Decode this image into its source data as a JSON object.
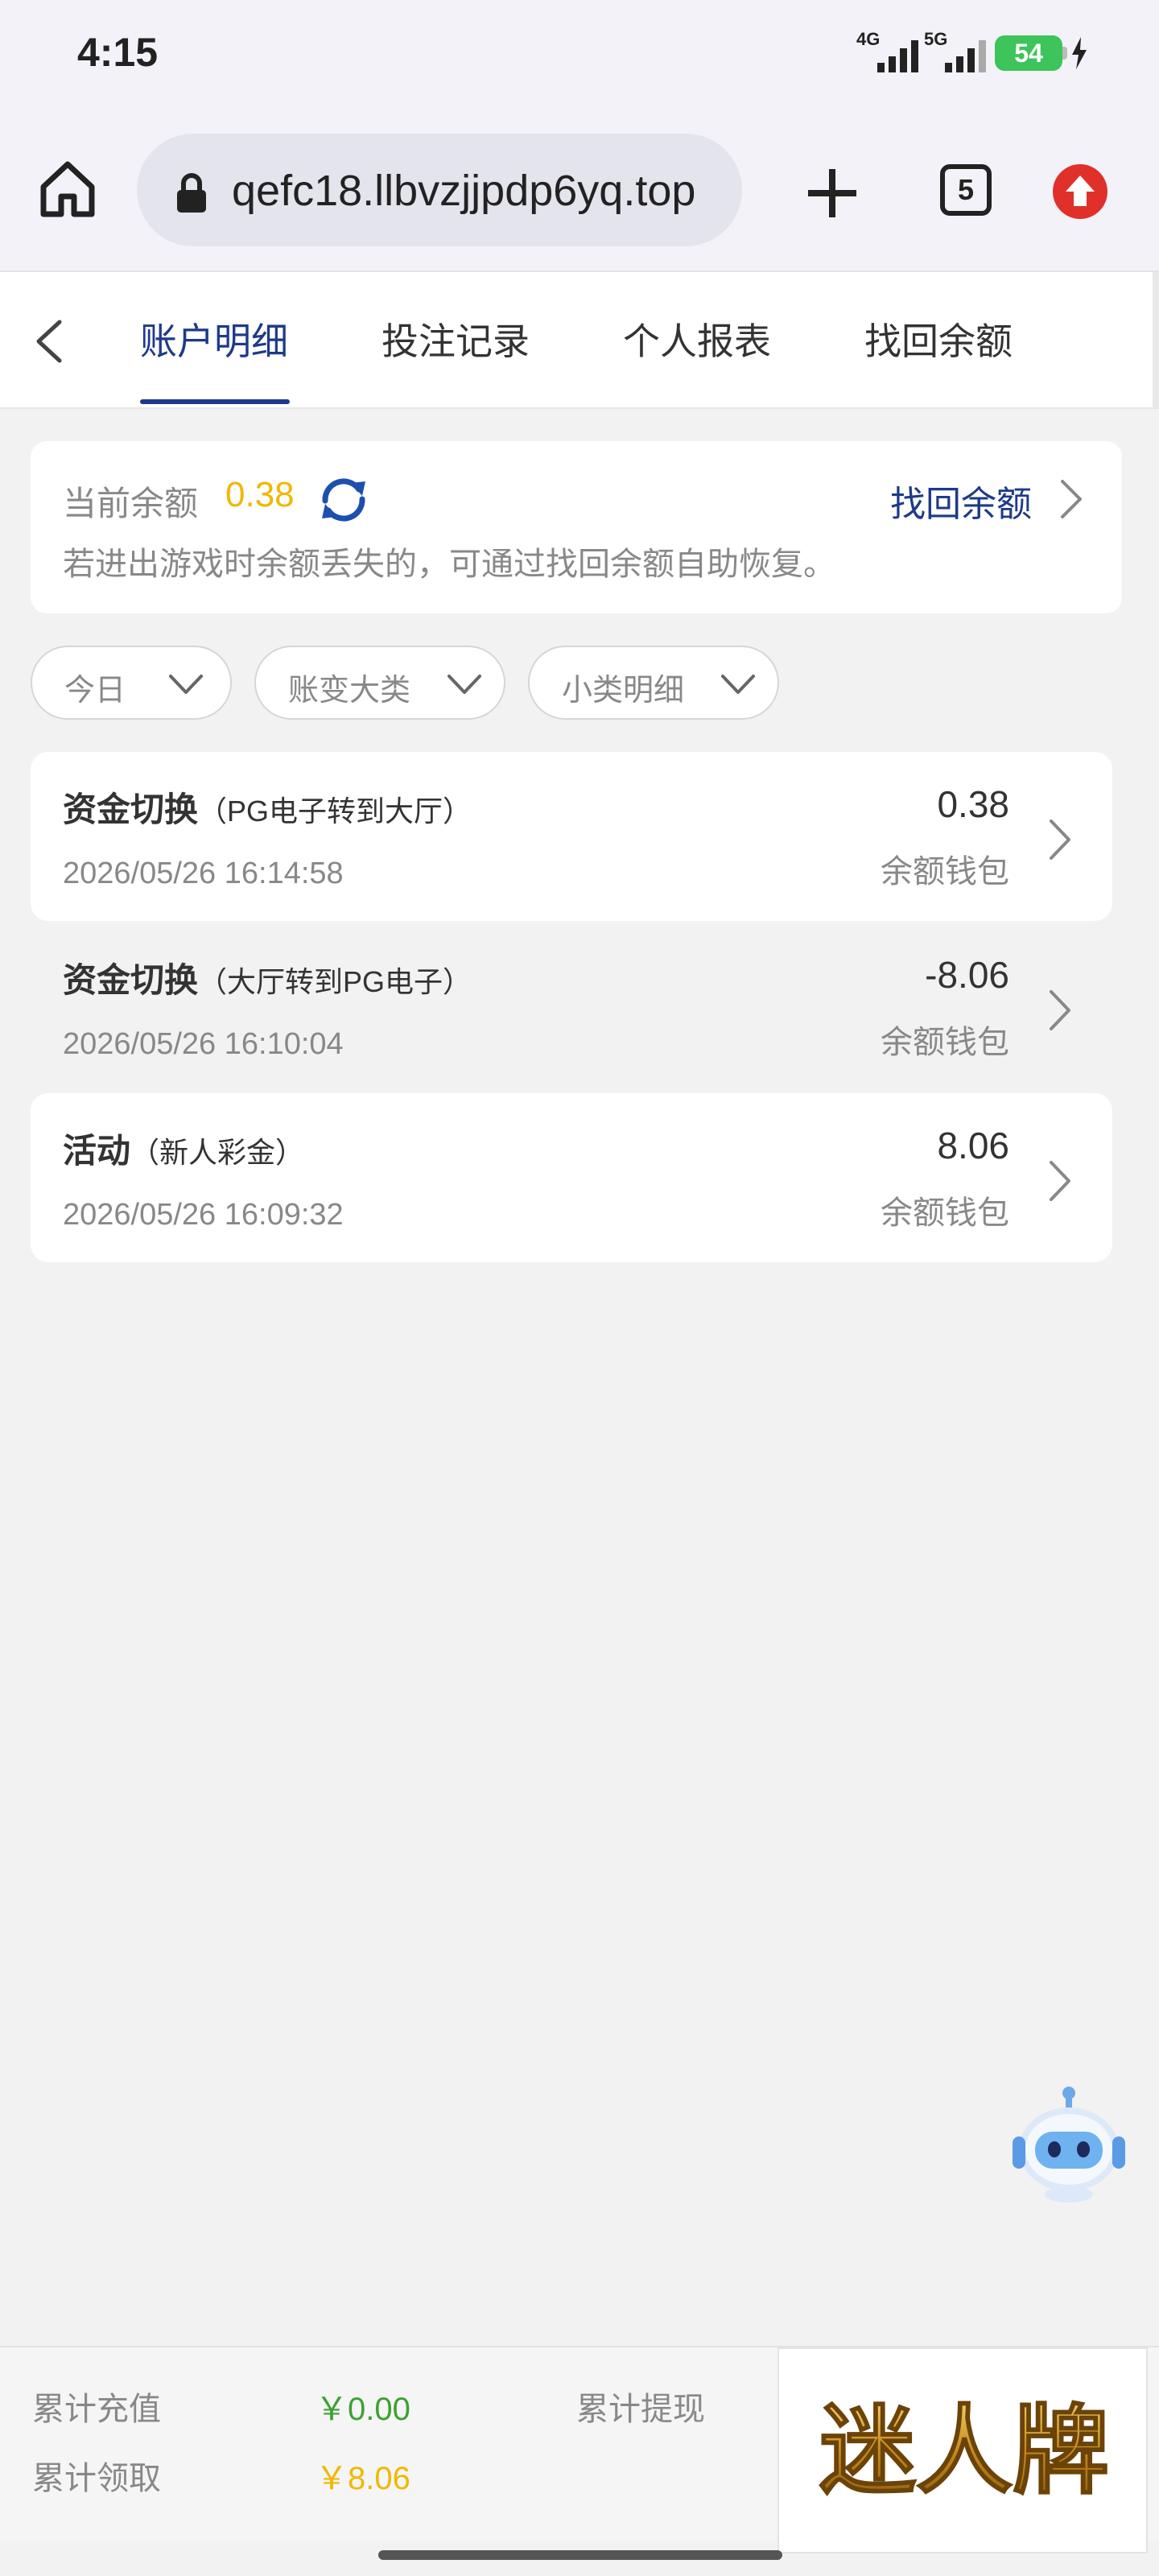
{
  "status_bar": {
    "time": "4:15",
    "signal1": "4G",
    "signal2": "5G",
    "battery": "54"
  },
  "browser": {
    "url": "qefc18.llbvzjjpdp6yq.top",
    "tab_count": "5"
  },
  "nav": {
    "tabs": [
      "账户明细",
      "投注记录",
      "个人报表",
      "找回余额"
    ],
    "active_index": 0
  },
  "balance": {
    "label": "当前余额",
    "value": "0.38",
    "recover_link": "找回余额",
    "note": "若进出游戏时余额丢失的，可通过找回余额自助恢复。"
  },
  "filters": [
    "今日",
    "账变大类",
    "小类明细"
  ],
  "records": [
    {
      "title": "资金切换",
      "detail": "（PG电子转到大厅）",
      "datetime": "2026/05/26 16:14:58",
      "amount": "0.38",
      "wallet": "余额钱包"
    },
    {
      "title": "资金切换",
      "detail": "（大厅转到PG电子）",
      "datetime": "2026/05/26 16:10:04",
      "amount": "-8.06",
      "wallet": "余额钱包"
    },
    {
      "title": "活动",
      "detail": "（新人彩金）",
      "datetime": "2026/05/26 16:09:32",
      "amount": "8.06",
      "wallet": "余额钱包"
    }
  ],
  "footer": {
    "total_recharge_label": "累计充值",
    "total_recharge_value": "￥0.00",
    "total_withdraw_label": "累计提现",
    "total_claim_label": "累计领取",
    "total_claim_value": "￥8.06",
    "logo_text": "迷人牌"
  },
  "colors": {
    "accent_blue": "#1d3a8a",
    "gold": "#f0b800",
    "green": "#3da130"
  }
}
